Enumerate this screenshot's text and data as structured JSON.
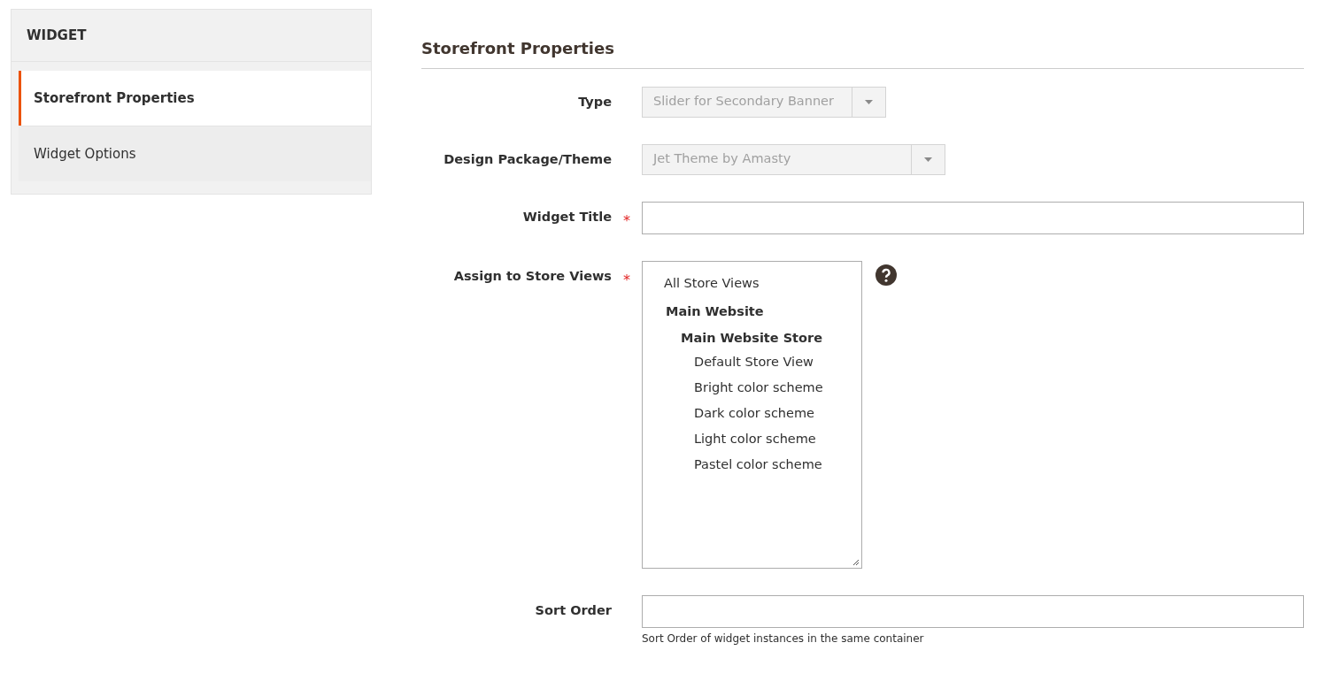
{
  "sidebar": {
    "title": "WIDGET",
    "items": [
      {
        "label": "Storefront Properties",
        "selected": true
      },
      {
        "label": "Widget Options",
        "selected": false
      }
    ]
  },
  "section_title": "Storefront Properties",
  "fields": [
    {
      "kind": "select",
      "label": "Type",
      "disabled": true,
      "value": "Slider for Secondary Banner"
    },
    {
      "kind": "select",
      "label": "Design Package/Theme",
      "disabled": true,
      "value": "Jet Theme by Amasty"
    },
    {
      "kind": "text",
      "label": "Widget Title",
      "required_mark": "*",
      "disabled": false
    },
    {
      "kind": "multiselect",
      "label": "Assign to Store Views",
      "required_mark": "*",
      "disabled": false,
      "help_icon": true,
      "options": [
        {
          "kind": "option",
          "label": "All Store Views",
          "selected": false
        },
        {
          "kind": "group",
          "label": "Main Website",
          "children": [
            {
              "kind": "group",
              "label": "Main Website Store",
              "children": [
                {
                  "kind": "option",
                  "label": "Default Store View",
                  "selected": false
                },
                {
                  "kind": "option",
                  "label": "Bright color scheme",
                  "selected": false
                },
                {
                  "kind": "option",
                  "label": "Dark color scheme",
                  "selected": false
                },
                {
                  "kind": "option",
                  "label": "Light color scheme",
                  "selected": false
                },
                {
                  "kind": "option",
                  "label": "Pastel color scheme",
                  "selected": false
                }
              ]
            }
          ]
        }
      ]
    },
    {
      "kind": "text",
      "label": "Sort Order",
      "disabled": false,
      "note": "Sort Order of widget instances in the same container"
    }
  ]
}
